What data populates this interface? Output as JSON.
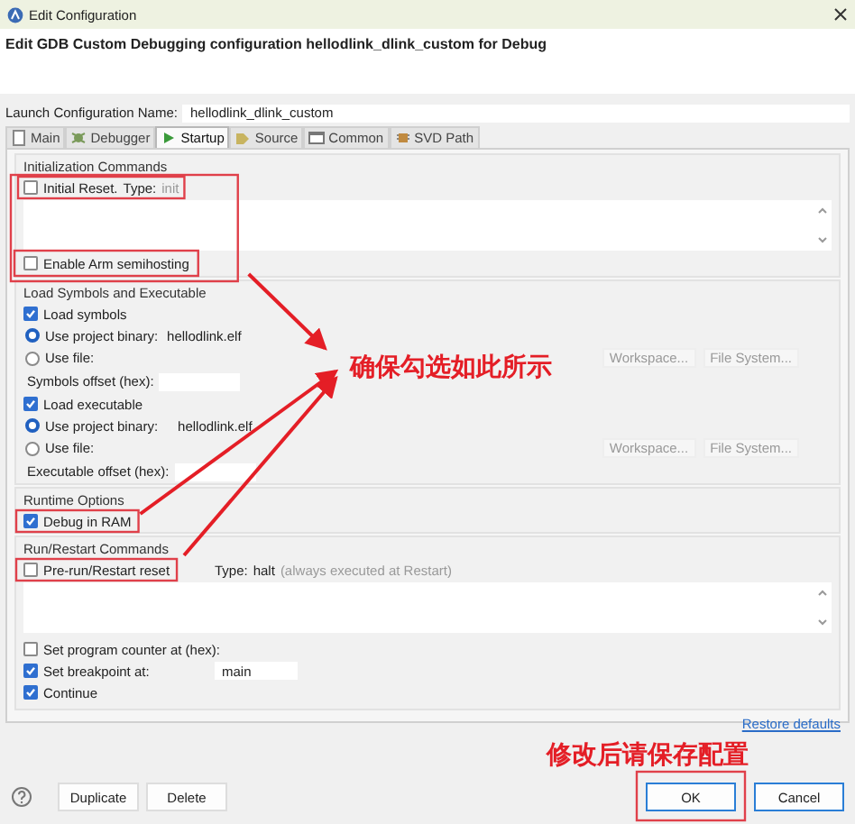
{
  "window": {
    "title": "Edit Configuration"
  },
  "header": "Edit GDB Custom Debugging configuration hellodlink_dlink_custom for Debug",
  "name_field": {
    "label": "Launch Configuration Name:",
    "value": "hellodlink_dlink_custom"
  },
  "tabs": [
    {
      "label": "Main",
      "selected": false
    },
    {
      "label": "Debugger",
      "selected": false
    },
    {
      "label": "Startup",
      "selected": true
    },
    {
      "label": "Source",
      "selected": false
    },
    {
      "label": "Common",
      "selected": false
    },
    {
      "label": "SVD Path",
      "selected": false
    }
  ],
  "init": {
    "title": "Initialization Commands",
    "initial_reset": {
      "label": "Initial Reset.",
      "checked": false
    },
    "type_label": "Type:",
    "type_value": "init",
    "semihosting": {
      "label": "Enable Arm semihosting",
      "checked": false
    }
  },
  "load": {
    "title": "Load Symbols and Executable",
    "sections": [
      {
        "check": {
          "label": "Load symbols",
          "checked": true
        },
        "project": {
          "label": "Use project binary:",
          "value": "hellodlink.elf",
          "selected": true
        },
        "file": {
          "label": "Use file:",
          "selected": false
        },
        "workspace": "Workspace...",
        "file_system": "File System...",
        "offset_label": "Symbols offset (hex):"
      },
      {
        "check": {
          "label": "Load executable",
          "checked": true
        },
        "project": {
          "label": "Use project binary:",
          "value": "hellodlink.elf",
          "selected": true
        },
        "file": {
          "label": "Use file:",
          "selected": false
        },
        "workspace": "Workspace...",
        "file_system": "File System...",
        "offset_label": "Executable offset (hex):"
      }
    ]
  },
  "runtime": {
    "title": "Runtime Options",
    "debug_in_ram": {
      "label": "Debug in RAM",
      "checked": true
    }
  },
  "restart": {
    "title": "Run/Restart Commands",
    "reset": {
      "label": "Pre-run/Restart reset",
      "checked": false
    },
    "type_label": "Type:",
    "type_value": "halt",
    "type_note": "(always executed at Restart)",
    "options": [
      {
        "label": "Set program counter at (hex):",
        "checked": false
      },
      {
        "label": "Set breakpoint at:",
        "checked": true,
        "value": "main"
      },
      {
        "label": "Continue",
        "checked": true
      }
    ]
  },
  "restore_link": "Restore defaults",
  "annotations": [
    "确保勾选如此所示",
    "修改后请保存配置"
  ],
  "buttons": {
    "left": [
      "Duplicate",
      "Delete"
    ],
    "right": [
      "OK",
      "Cancel"
    ]
  }
}
